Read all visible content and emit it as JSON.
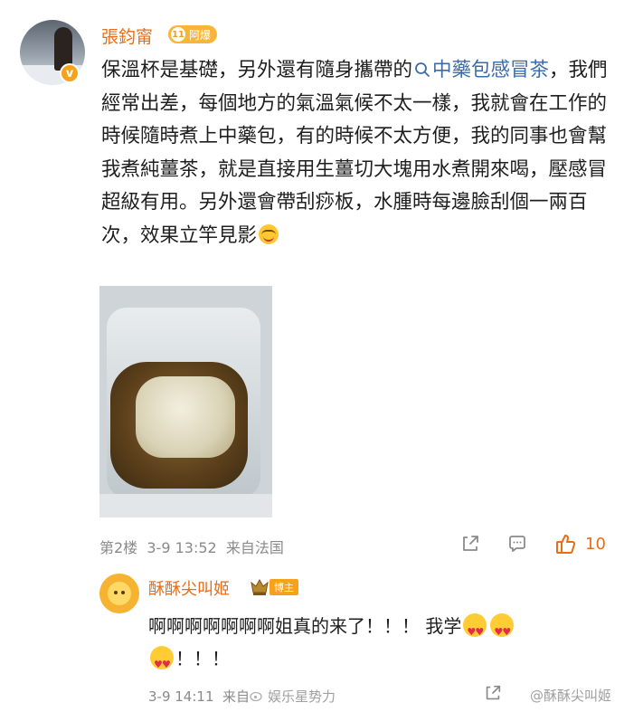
{
  "post": {
    "author": "張鈞甯",
    "level": "11",
    "level_label": "阿爆",
    "verified_mark": "v",
    "text_before_link": "保溫杯是基礎，另外還有隨身攜帶的",
    "link_icon": "search-icon",
    "link_text": "中藥包感冒茶",
    "text_after_link": "，我們經常出差，每個地方的氣溫氣候不太一樣，我就會在工作的時候隨時煮上中藥包，有的時候不太方便，我的同事也會幫我煮純薑茶，就是直接用生薑切大塊用水煮開來喝，壓感冒超級有用。另外還會帶刮痧板，水腫時每邊臉刮個一兩百次，效果立竿見影",
    "floor": "第2楼",
    "date": "3-9 13:52",
    "location": "来自法国",
    "likes": "10"
  },
  "reply": {
    "author": "酥酥尖叫姬",
    "badge": "博主",
    "text_main": "啊啊啊啊啊啊啊姐真的来了！！！ 我学",
    "text_tail": "！！！",
    "date": "3-9 14:11",
    "location_partial": "来自",
    "watermark_left": "娱乐星势力",
    "watermark_right": "@酥酥尖叫姬"
  },
  "colors": {
    "accent": "#e76d16",
    "link": "#3f6aa8",
    "meta": "#8a8a8a"
  }
}
